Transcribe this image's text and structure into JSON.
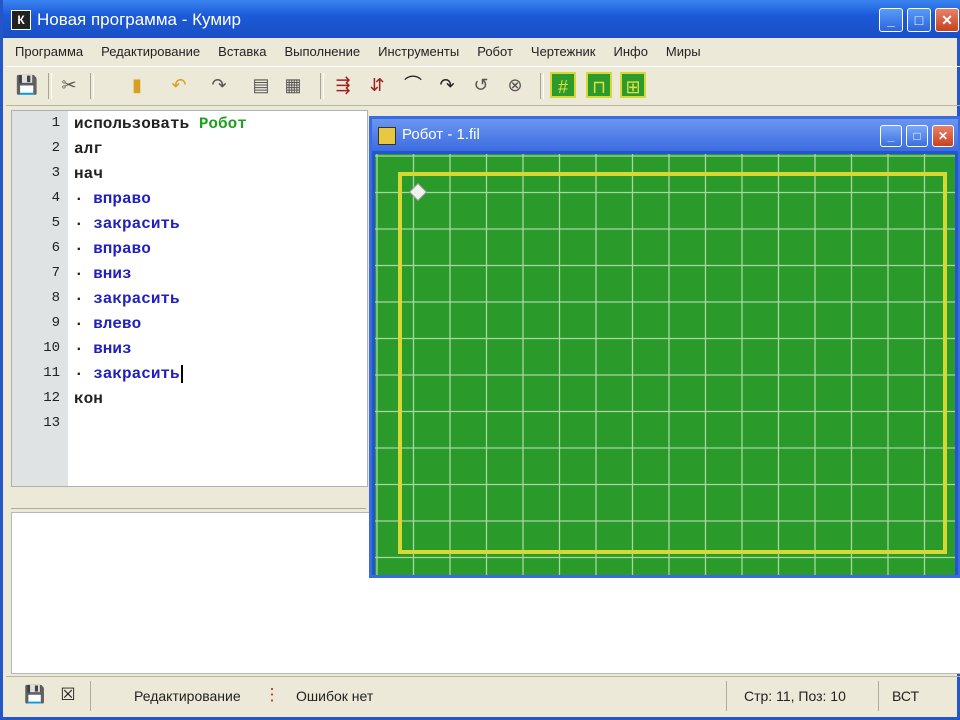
{
  "window": {
    "title": "Новая программа - Кумир",
    "app_icon_letter": "К",
    "minimize": "_",
    "maximize": "□",
    "close": "✕"
  },
  "menu": [
    "Программа",
    "Редактирование",
    "Вставка",
    "Выполнение",
    "Инструменты",
    "Робот",
    "Чертежник",
    "Инфо",
    "Миры"
  ],
  "toolbar": {
    "icons": [
      "save-icon",
      "cut-icon",
      "paste-icon",
      "undo-icon",
      "redo-icon",
      "block-icon",
      "block-icon-2",
      "robot-cmd-icon",
      "robot-cmd-icon-2",
      "arc-icon",
      "arc-icon-2",
      "arc-icon-3",
      "stop-icon",
      "grid-icon",
      "frame-icon",
      "grid-icon-2"
    ]
  },
  "editor": {
    "lines": [
      {
        "n": "1",
        "parts": [
          {
            "t": "использовать ",
            "c": "kw"
          },
          {
            "t": "Робот",
            "c": "mod"
          }
        ]
      },
      {
        "n": "2",
        "parts": [
          {
            "t": "алг",
            "c": "kw"
          }
        ]
      },
      {
        "n": "3",
        "parts": [
          {
            "t": "нач",
            "c": "kw"
          }
        ]
      },
      {
        "n": "4",
        "parts": [
          {
            "t": "· ",
            "c": "kw"
          },
          {
            "t": "вправо",
            "c": "cmd"
          }
        ]
      },
      {
        "n": "5",
        "parts": [
          {
            "t": "· ",
            "c": "kw"
          },
          {
            "t": "закрасить",
            "c": "cmd"
          }
        ]
      },
      {
        "n": "6",
        "parts": [
          {
            "t": "· ",
            "c": "kw"
          },
          {
            "t": "вправо",
            "c": "cmd"
          }
        ]
      },
      {
        "n": "7",
        "parts": [
          {
            "t": "· ",
            "c": "kw"
          },
          {
            "t": "вниз",
            "c": "cmd"
          }
        ]
      },
      {
        "n": "8",
        "parts": [
          {
            "t": "· ",
            "c": "kw"
          },
          {
            "t": "закрасить",
            "c": "cmd"
          }
        ]
      },
      {
        "n": "9",
        "parts": [
          {
            "t": "· ",
            "c": "kw"
          },
          {
            "t": "влево",
            "c": "cmd"
          }
        ]
      },
      {
        "n": "10",
        "parts": [
          {
            "t": "· ",
            "c": "kw"
          },
          {
            "t": "вниз",
            "c": "cmd"
          }
        ]
      },
      {
        "n": "11",
        "parts": [
          {
            "t": "· ",
            "c": "kw"
          },
          {
            "t": "закрасить",
            "c": "cmd"
          }
        ]
      },
      {
        "n": "12",
        "parts": [
          {
            "t": "кон",
            "c": "kw"
          }
        ]
      },
      {
        "n": "13",
        "parts": []
      }
    ]
  },
  "robot": {
    "title": "Робот - 1.fil",
    "field_color": "#2a9a2a",
    "grid_color": "#a8d8a0",
    "wall_color": "#d8d832",
    "robot_color": "#f0f0f0"
  },
  "status": {
    "mode": "Редактирование",
    "errors": "Ошибок нет",
    "position": "Стр: 11, Поз: 10",
    "insert": "ВСТ"
  }
}
